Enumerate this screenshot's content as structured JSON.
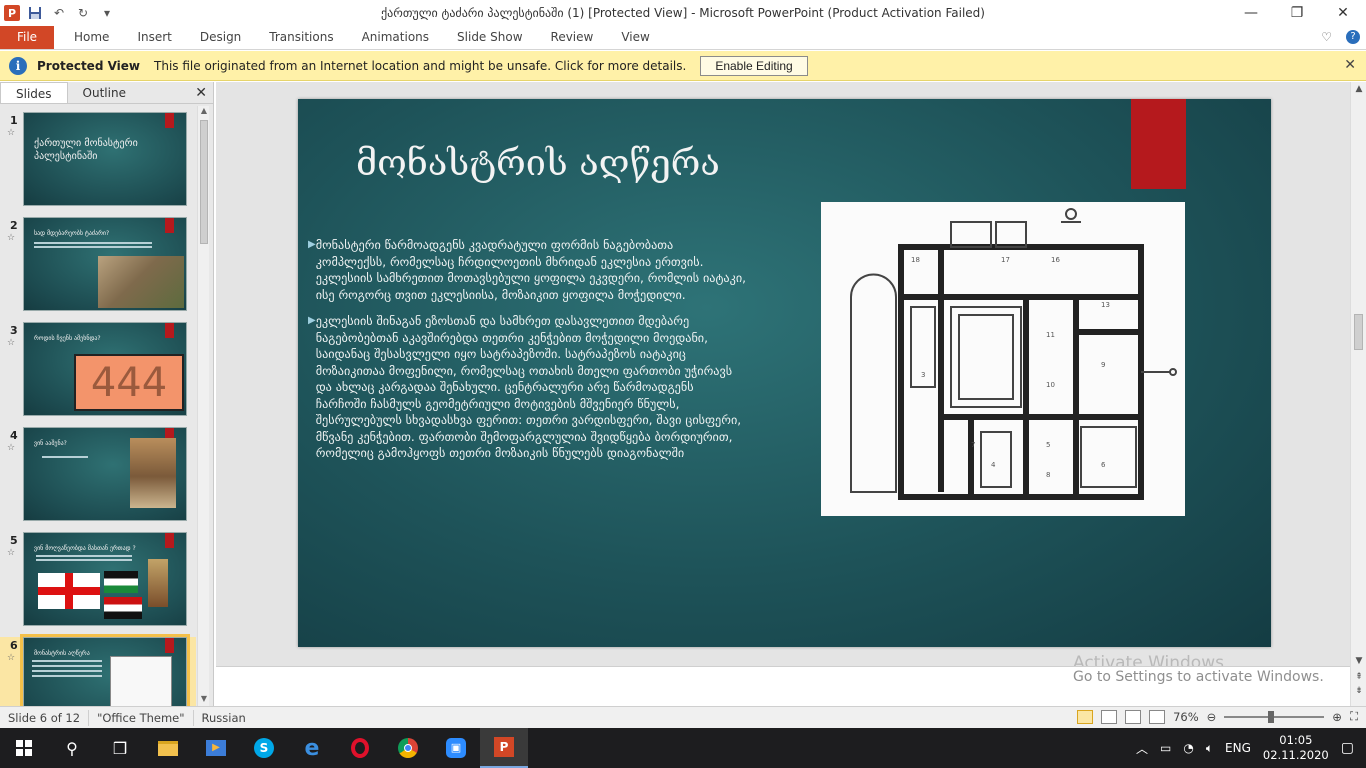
{
  "window": {
    "title": "ქართული ტაძარი პალესტინაში (1) [Protected View]  -  Microsoft PowerPoint (Product Activation Failed)"
  },
  "ribbon": {
    "tabs": [
      "File",
      "Home",
      "Insert",
      "Design",
      "Transitions",
      "Animations",
      "Slide Show",
      "Review",
      "View"
    ]
  },
  "protected_view": {
    "title": "Protected View",
    "message": "This file originated from an Internet location and might be unsafe. Click for more details.",
    "button": "Enable Editing"
  },
  "panel": {
    "tab_slides": "Slides",
    "tab_outline": "Outline",
    "thumbnails": [
      {
        "num": "1",
        "title": "ქართული მონასტერი პალესტინაში"
      },
      {
        "num": "2",
        "title": "სად მდებარეობს ტაძარი?"
      },
      {
        "num": "3",
        "title": "როდის ჩვენს ამეხნდა?",
        "image_text": "444"
      },
      {
        "num": "4",
        "title": "ვინ ააშენა?"
      },
      {
        "num": "5",
        "title": "ვინ მოღვაწეობდა მასთან ერთად ?"
      },
      {
        "num": "6",
        "title": "მონასტრის აღწერა"
      }
    ]
  },
  "slide": {
    "title": "მონასტრის აღწერა",
    "bullets": [
      "მონასტერი წარმოადგენს კვადრატული ფორმის ნაგებობათა კომპლექსს, რომელსაც ჩრდილოეთის მხრიდან ეკლესია ერთვის. ეკლესიის სამხრეთით მოთავსებული ყოფილა ეკვდერი, რომლის იატაკი, ისე როგორც თვით ეკლესიისა, მოზაიკით ყოფილა მოჭედილი.",
      "ეკლესიის შინაგან ეზოსთან და სამხრეთ დასავლეთით მდებარე ნაგებობებთან აკავშირებდა თეთრი კენჭებით მოჭედილი მოედანი, საიდანაც შესასვლელი იყო სატრაპეზოში. სატრაპეზოს იატაკიც მოზაიკითაა მოფენილი, რომელსაც ოთახის მთელი ფართობი უჭირავს და ახლაც კარგადაა შენახული. ცენტრალური არე წარმოადგენს ჩარჩოში ჩასმულს გეომეტრიული მოტივების მშვენიერ წნულს, შესრულებულს სხვადასხვა ფერით: თეთრი ვარდისფერი, შავი ცისფერი, მწვანე კენჭებით. ფართობი შემოფარგლულია შვიდწყება ბორდიურით, რომელიც გამოჰყოფს თეთრი მოზაიკის წნულებს დიაგონალში"
    ]
  },
  "watermark": {
    "line1": "Activate Windows",
    "line2": "Go to Settings to activate Windows."
  },
  "status": {
    "slide_info": "Slide 6 of 12",
    "theme": "\"Office Theme\"",
    "language": "Russian",
    "zoom": "76%"
  },
  "taskbar": {
    "lang": "ENG",
    "time": "01:05",
    "date": "02.11.2020"
  }
}
